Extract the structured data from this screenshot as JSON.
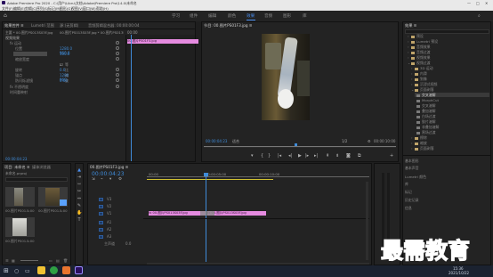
{
  "window": {
    "title": "Adobe Premiere Pro 2020 - C:\\用户\\Libru\\文档\\Adobe\\Premiere Pro\\14.0\\未命名",
    "controls": [
      "—",
      "□",
      "✕"
    ]
  },
  "menu": [
    "文件(F)",
    "编辑(E)",
    "剪辑(C)",
    "序列(S)",
    "标记(M)",
    "图形(G)",
    "视图(V)",
    "窗口(W)",
    "帮助(H)"
  ],
  "workspaces": {
    "home": "⌂",
    "items": [
      "学习",
      "组件",
      "编辑",
      "颜色",
      "效果",
      "音频",
      "图形",
      "库"
    ],
    "active": "效果"
  },
  "effect_controls": {
    "tabs": [
      "效果控件 ≡",
      "Lumetri 范围",
      "源:(无剪辑)",
      "音频剪辑混合器: 00:00:00:04"
    ],
    "master": "主要 * 00.图片PS013S03F.jpg",
    "sequence": "00.图片PS013S03F.jpg * 00.图片PS013S03F.jpg",
    "section_video": "视频效果",
    "clip_label": "00.图片PS01F3.jpg",
    "timecode": "00:00",
    "rows": [
      {
        "name": "fx 运动",
        "value": ""
      },
      {
        "name": "位置",
        "value": "1280.0   960.0"
      },
      {
        "name": "缩放",
        "value": "100.0"
      },
      {
        "name": "缩放宽度",
        "value": ""
      },
      {
        "name": "等比缩放",
        "value": "☑"
      },
      {
        "name": "旋转",
        "value": "0.0"
      },
      {
        "name": "锚点",
        "value": "1280   960"
      },
      {
        "name": "防闪烁滤镜",
        "value": "0.00"
      },
      {
        "name": "fx 不透明度",
        "value": ""
      },
      {
        "name": "时间重映射",
        "value": ""
      }
    ],
    "bottom_time": "00:00:04:23"
  },
  "program": {
    "title": "节目: 00.图片PS01F3.jpg ≡",
    "timecode_left": "00:00:04:23",
    "fit": "适合",
    "quality": "1/2",
    "timecode_right": "00:00:10:00"
  },
  "library": {
    "title": "效果 ≡",
    "items": [
      {
        "label": "预设",
        "indent": 0
      },
      {
        "label": "Lumetri 预设",
        "indent": 0
      },
      {
        "label": "音频效果",
        "indent": 0
      },
      {
        "label": "音频过渡",
        "indent": 0
      },
      {
        "label": "视频效果",
        "indent": 0
      },
      {
        "label": "视频过渡",
        "indent": 0
      },
      {
        "label": "3D 运动",
        "indent": 1
      },
      {
        "label": "内滑",
        "indent": 1
      },
      {
        "label": "划像",
        "indent": 1
      },
      {
        "label": "沉浸式视频",
        "indent": 1
      },
      {
        "label": "页面剥落",
        "indent": 1
      },
      {
        "label": "交叉溶解",
        "indent": 2
      },
      {
        "label": "MorphCut",
        "indent": 2
      },
      {
        "label": "交叉溶解",
        "indent": 2
      },
      {
        "label": "叠加溶解",
        "indent": 2
      },
      {
        "label": "白场过渡",
        "indent": 2
      },
      {
        "label": "胶片溶解",
        "indent": 2
      },
      {
        "label": "非叠加溶解",
        "indent": 2
      },
      {
        "label": "黑场过渡",
        "indent": 2
      },
      {
        "label": "擦除",
        "indent": 1
      },
      {
        "label": "缩放",
        "indent": 1
      },
      {
        "label": "页面剥落",
        "indent": 1
      }
    ],
    "bottom": [
      "基本图形",
      "基本声音",
      "Lumetri 颜色",
      "库",
      "标记",
      "历史记录",
      "信息"
    ]
  },
  "project": {
    "tabs": [
      "项目: 未命名 ≡",
      "媒体浏览器"
    ],
    "path": "未命名.prproj",
    "items": [
      {
        "name": "00.图片PS01...",
        "dur": "5:00"
      },
      {
        "name": "00.图片PS01...",
        "dur": "5:00"
      },
      {
        "name": "00.图片PS01...",
        "dur": "5:00"
      }
    ]
  },
  "timeline": {
    "title": "00.图片PS01F3.jpg ≡",
    "timecode": "00:00:04:23",
    "ruler": [
      "00:00",
      "00:00:05:00",
      "00:00:10:00"
    ],
    "tracks": [
      "V3",
      "V2",
      "V1",
      "A1",
      "A2",
      "A3"
    ],
    "master": "主声道",
    "master_val": "0.0",
    "clips": [
      {
        "label": "fx 00.图片PS013S03F.jpg",
        "track": "V1"
      },
      {
        "label": "fx 00.图片PS013S03F.jpg",
        "track": "V1"
      }
    ]
  },
  "taskbar": {
    "time": "15:36",
    "date": "2021/10/22"
  },
  "watermark": "最需教育",
  "colors": {
    "accent": "#4a8ff0",
    "clip": "#e58be0",
    "bg": "#232323",
    "playhead": "#3f8bd8"
  }
}
